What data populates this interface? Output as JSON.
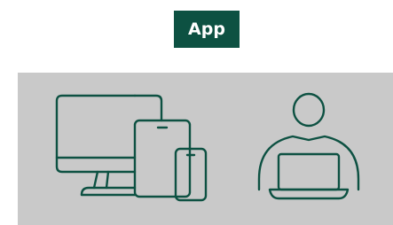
{
  "header": {
    "badge_label": "App"
  },
  "illustration": {
    "icons": [
      "devices-icon",
      "user-laptop-icon"
    ]
  },
  "colors": {
    "accent": "#0d5142",
    "panel_background": "#c9c9c9",
    "page_background": "#ffffff"
  }
}
